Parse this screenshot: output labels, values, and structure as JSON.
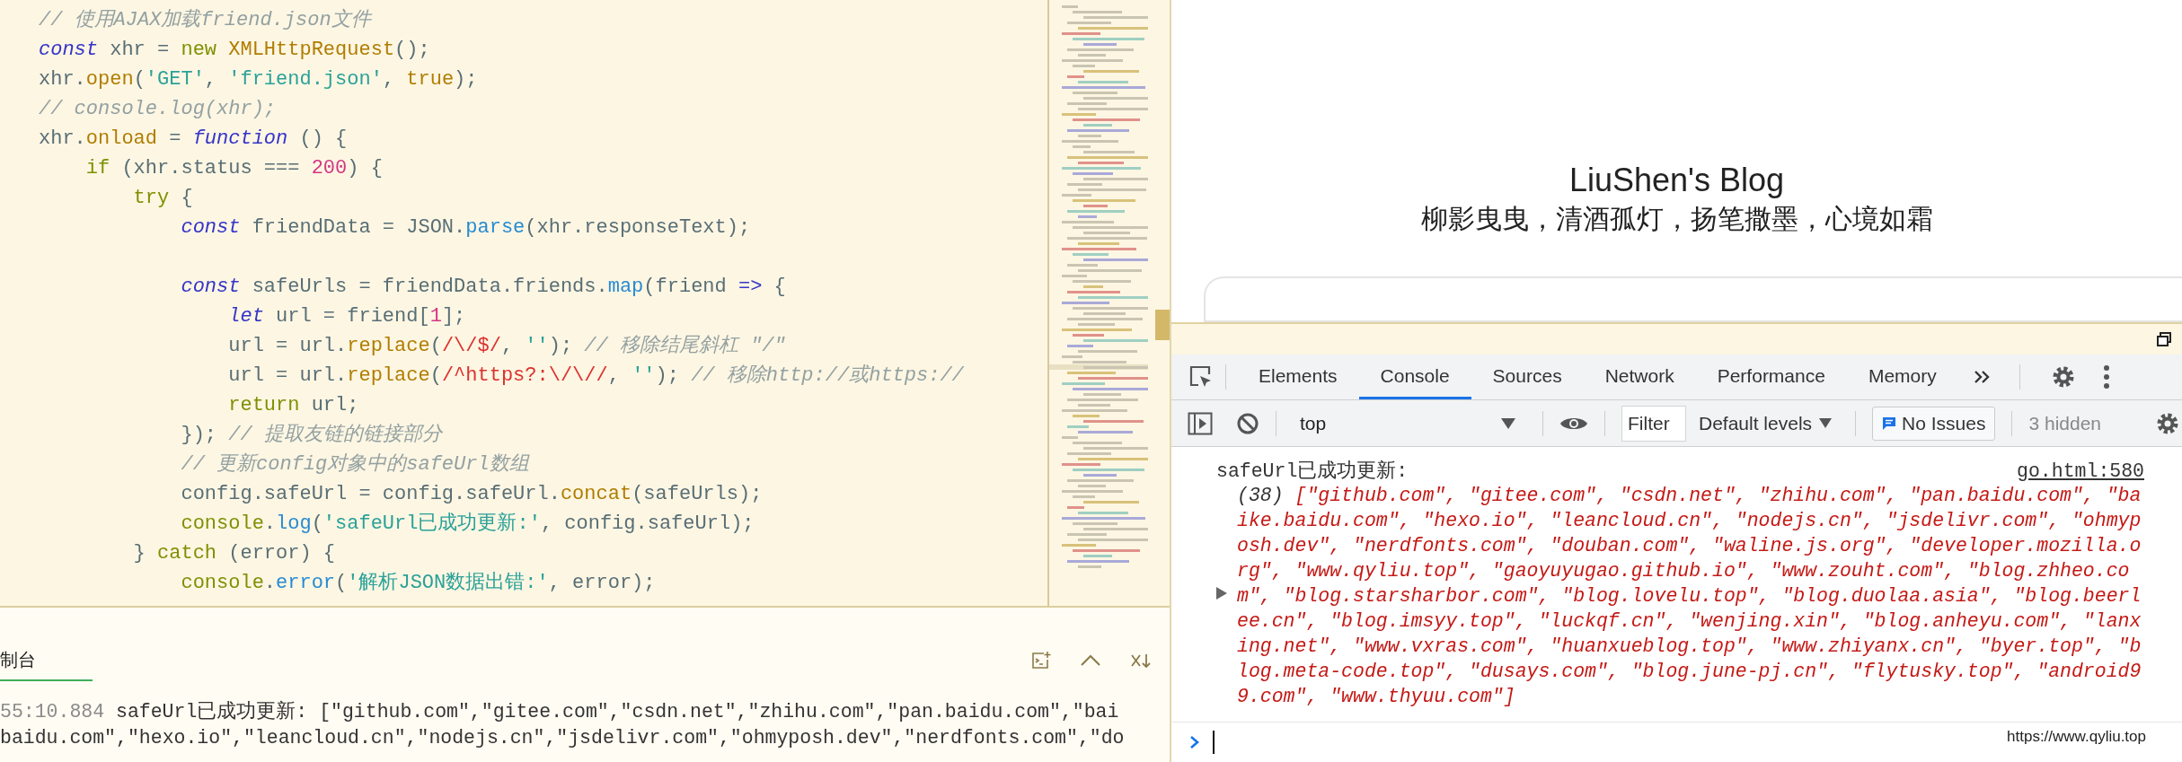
{
  "editor": {
    "lines": [
      {
        "kind": "code",
        "tokens": [
          {
            "text": "// 使用AJAX加载friend.json文件",
            "kind": "comment"
          }
        ]
      },
      {
        "kind": "code",
        "tokens": [
          {
            "text": "const",
            "kind": "decl"
          },
          {
            "text": " xhr = ",
            "kind": "plain"
          },
          {
            "text": "new ",
            "kind": "kw"
          },
          {
            "text": "XMLHttpRequest",
            "kind": "cls"
          },
          {
            "text": "();",
            "kind": "plain"
          }
        ]
      },
      {
        "kind": "code",
        "tokens": [
          {
            "text": "xhr.",
            "kind": "plain"
          },
          {
            "text": "open",
            "kind": "cls"
          },
          {
            "text": "(",
            "kind": "plain"
          },
          {
            "text": "'GET'",
            "kind": "str"
          },
          {
            "text": ", ",
            "kind": "plain"
          },
          {
            "text": "'friend.json'",
            "kind": "str"
          },
          {
            "text": ", ",
            "kind": "plain"
          },
          {
            "text": "true",
            "kind": "cls"
          },
          {
            "text": ");",
            "kind": "plain"
          }
        ]
      },
      {
        "kind": "code",
        "tokens": [
          {
            "text": "// console.log(xhr);",
            "kind": "comment"
          }
        ]
      },
      {
        "kind": "code",
        "tokens": [
          {
            "text": "xhr.",
            "kind": "plain"
          },
          {
            "text": "onload",
            "kind": "cls"
          },
          {
            "text": " = ",
            "kind": "plain"
          },
          {
            "text": "function",
            "kind": "decl"
          },
          {
            "text": " () {",
            "kind": "plain"
          }
        ]
      },
      {
        "kind": "code",
        "tokens": [
          {
            "text": "    if",
            "kind": "kw"
          },
          {
            "text": " (xhr.status === ",
            "kind": "plain"
          },
          {
            "text": "200",
            "kind": "num"
          },
          {
            "text": ") {",
            "kind": "plain"
          }
        ]
      },
      {
        "kind": "code",
        "tokens": [
          {
            "text": "        try",
            "kind": "kw"
          },
          {
            "text": " {",
            "kind": "plain"
          }
        ]
      },
      {
        "kind": "code",
        "tokens": [
          {
            "text": "            const",
            "kind": "decl"
          },
          {
            "text": " friendData = JSON.",
            "kind": "plain"
          },
          {
            "text": "parse",
            "kind": "fn"
          },
          {
            "text": "(xhr.responseText);",
            "kind": "plain"
          }
        ]
      },
      {
        "kind": "blank"
      },
      {
        "kind": "code",
        "tokens": [
          {
            "text": "            const",
            "kind": "decl"
          },
          {
            "text": " safeUrls = friendData.friends.",
            "kind": "plain"
          },
          {
            "text": "map",
            "kind": "fn"
          },
          {
            "text": "(friend ",
            "kind": "plain"
          },
          {
            "text": "=>",
            "kind": "decl"
          },
          {
            "text": " {",
            "kind": "plain"
          }
        ]
      },
      {
        "kind": "code",
        "tokens": [
          {
            "text": "                let",
            "kind": "decl"
          },
          {
            "text": " url = friend[",
            "kind": "plain"
          },
          {
            "text": "1",
            "kind": "num"
          },
          {
            "text": "];",
            "kind": "plain"
          }
        ]
      },
      {
        "kind": "code",
        "tokens": [
          {
            "text": "                url = url.",
            "kind": "plain"
          },
          {
            "text": "replace",
            "kind": "cls"
          },
          {
            "text": "(",
            "kind": "plain"
          },
          {
            "text": "/\\/$/",
            "kind": "regex"
          },
          {
            "text": ", ",
            "kind": "plain"
          },
          {
            "text": "''",
            "kind": "str"
          },
          {
            "text": "); ",
            "kind": "plain"
          },
          {
            "text": "// 移除结尾斜杠 \"/\"",
            "kind": "comment"
          }
        ]
      },
      {
        "kind": "code",
        "tokens": [
          {
            "text": "                url = url.",
            "kind": "plain"
          },
          {
            "text": "replace",
            "kind": "cls"
          },
          {
            "text": "(",
            "kind": "plain"
          },
          {
            "text": "/^https?:\\/\\//",
            "kind": "regex"
          },
          {
            "text": ", ",
            "kind": "plain"
          },
          {
            "text": "''",
            "kind": "str"
          },
          {
            "text": "); ",
            "kind": "plain"
          },
          {
            "text": "// 移除http://或https://",
            "kind": "comment"
          }
        ]
      },
      {
        "kind": "code",
        "tokens": [
          {
            "text": "                return",
            "kind": "kw"
          },
          {
            "text": " url;",
            "kind": "plain"
          }
        ]
      },
      {
        "kind": "code",
        "tokens": [
          {
            "text": "            }); ",
            "kind": "plain"
          },
          {
            "text": "// 提取友链的链接部分",
            "kind": "comment"
          }
        ]
      },
      {
        "kind": "code",
        "tokens": [
          {
            "text": "            // 更新config对象中的safeUrl数组",
            "kind": "comment"
          }
        ]
      },
      {
        "kind": "code",
        "tokens": [
          {
            "text": "            config.safeUrl = config.safeUrl.",
            "kind": "plain"
          },
          {
            "text": "concat",
            "kind": "cls"
          },
          {
            "text": "(safeUrls);",
            "kind": "plain"
          }
        ]
      },
      {
        "kind": "code",
        "tokens": [
          {
            "text": "            console",
            "kind": "kw"
          },
          {
            "text": ".",
            "kind": "plain"
          },
          {
            "text": "log",
            "kind": "fn"
          },
          {
            "text": "(",
            "kind": "plain"
          },
          {
            "text": "'safeUrl已成功更新:'",
            "kind": "str"
          },
          {
            "text": ", config.safeUrl);",
            "kind": "plain"
          }
        ]
      },
      {
        "kind": "code",
        "tokens": [
          {
            "text": "        } ",
            "kind": "plain"
          },
          {
            "text": "catch",
            "kind": "kw"
          },
          {
            "text": " (error) {",
            "kind": "plain"
          }
        ]
      },
      {
        "kind": "code",
        "tokens": [
          {
            "text": "            console",
            "kind": "kw"
          },
          {
            "text": ".",
            "kind": "plain"
          },
          {
            "text": "error",
            "kind": "fn"
          },
          {
            "text": "(",
            "kind": "plain"
          },
          {
            "text": "'解析JSON数据出错:'",
            "kind": "str"
          },
          {
            "text": ", error);",
            "kind": "plain"
          }
        ]
      }
    ]
  },
  "bottom_panel": {
    "tab": {
      "label": "制台",
      "selected": true
    },
    "log_lines": [
      {
        "time": "55:10.884",
        "text": "safeUrl已成功更新: [\"github.com\",\"gitee.com\",\"csdn.net\",\"zhihu.com\",\"pan.baidu.com\",\"bai"
      },
      {
        "text": "baidu.com\",\"hexo.io\",\"leancloud.cn\",\"nodejs.cn\",\"jsdelivr.com\",\"ohmyposh.dev\",\"nerdfonts.com\",\"do"
      }
    ]
  },
  "page_preview": {
    "title": "LiuShen's Blog",
    "subtitle": "柳影曳曳，清酒孤灯，扬笔撒墨，心境如霜"
  },
  "devtools": {
    "tabs": [
      {
        "label": "Elements",
        "selected": false
      },
      {
        "label": "Console",
        "selected": true
      },
      {
        "label": "Sources",
        "selected": false
      },
      {
        "label": "Network",
        "selected": false
      },
      {
        "label": "Performance",
        "selected": false
      },
      {
        "label": "Memory",
        "selected": false
      }
    ],
    "toolbar": {
      "context": "top",
      "filter_placeholder": "Filter",
      "levels": "Default levels",
      "issues": "No Issues",
      "hidden": "3 hidden"
    },
    "console": {
      "message": "safeUrl已成功更新:",
      "source": "go.html:580",
      "count": "(38)",
      "array": "[\"github.com\", \"gitee.com\", \"csdn.net\", \"zhihu.com\", \"pan.baidu.com\", \"baike.baidu.com\", \"hexo.io\", \"leancloud.cn\", \"nodejs.cn\", \"jsdelivr.com\", \"ohmyposh.dev\", \"nerdfonts.com\", \"douban.com\", \"waline.js.org\", \"developer.mozilla.org\", \"www.qyliu.top\", \"gaoyuyugao.github.io\", \"www.zouht.com\", \"blog.zhheo.com\", \"blog.starsharbor.com\", \"blog.lovelu.top\", \"blog.duolaa.asia\", \"blog.beerlee.cn\", \"blog.imsyy.top\", \"luckqf.cn\", \"wenjing.xin\", \"blog.anheyu.com\", \"lanxing.net\", \"www.vxras.com\", \"huanxueblog.top\", \"www.zhiyanx.cn\", \"byer.top\", \"blog.meta-code.top\", \"dusays.com\", \"blog.june-pj.cn\", \"flytusky.top\", \"android99.com\", \"www.thyuu.com\"]"
    }
  },
  "link_tooltip": "https://www.qyliu.top"
}
